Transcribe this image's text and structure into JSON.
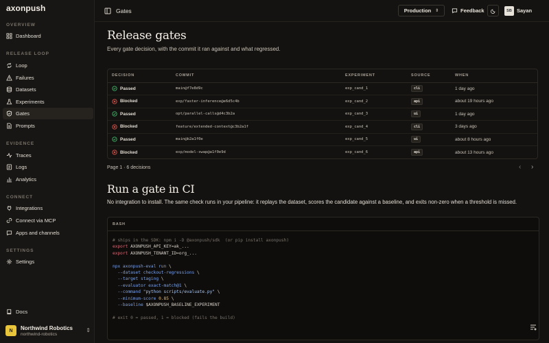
{
  "app": {
    "logo": "axonpush"
  },
  "sidebar": {
    "sections": [
      {
        "label": "OVERVIEW"
      },
      {
        "label": "RELEASE LOOP"
      },
      {
        "label": "EVIDENCE"
      },
      {
        "label": "CONNECT"
      },
      {
        "label": "SETTINGS"
      }
    ],
    "items": {
      "dashboard": "Dashboard",
      "loop": "Loop",
      "failures": "Failures",
      "datasets": "Datasets",
      "experiments": "Experiments",
      "gates": "Gates",
      "prompts": "Prompts",
      "traces": "Traces",
      "logs": "Logs",
      "analytics": "Analytics",
      "integrations": "Integrations",
      "mcp": "Connect via MCP",
      "apps": "Apps and channels",
      "settings": "Settings",
      "docs": "Docs"
    },
    "org": {
      "initial": "N",
      "name": "Northwind Robotics",
      "slug": "northwind-robotics"
    }
  },
  "topbar": {
    "breadcrumb": "Gates",
    "environment": "Production",
    "feedback": "Feedback",
    "user": {
      "initials": "SB",
      "name": "Sayan"
    }
  },
  "gates": {
    "title": "Release gates",
    "subtitle": "Every gate decision, with the commit it ran against and what regressed.",
    "columns": [
      "DECISION",
      "COMMIT",
      "EXPERIMENT",
      "SOURCE",
      "WHEN"
    ],
    "rows": [
      {
        "decision": "Passed",
        "status": "pass",
        "commit": "main@f7e8d9c",
        "experiment": "exp_cand_1",
        "source": "cli",
        "when": "1 day ago"
      },
      {
        "decision": "Blocked",
        "status": "block",
        "commit": "exp/faster-inference@e6d5c4b",
        "experiment": "exp_cand_2",
        "source": "api",
        "when": "about 19 hours ago"
      },
      {
        "decision": "Passed",
        "status": "pass",
        "commit": "opt/parallel-calls@d4c3b2a",
        "experiment": "exp_cand_3",
        "source": "ui",
        "when": "1 day ago"
      },
      {
        "decision": "Blocked",
        "status": "block",
        "commit": "feature/extended-context@c3b2a1f",
        "experiment": "exp_cand_4",
        "source": "cli",
        "when": "3 days ago"
      },
      {
        "decision": "Passed",
        "status": "pass",
        "commit": "main@b2a1f0e",
        "experiment": "exp_cand_5",
        "source": "ui",
        "when": "about 8 hours ago"
      },
      {
        "decision": "Blocked",
        "status": "block",
        "commit": "exp/model-swap@a1f0e9d",
        "experiment": "exp_cand_6",
        "source": "api",
        "when": "about 13 hours ago"
      }
    ],
    "pager": "Page 1 · 6 decisions",
    "colors": {
      "pass": "#3fb96b",
      "block": "#e0564f"
    }
  },
  "ci": {
    "title": "Run a gate in CI",
    "subtitle": "No integration to install. The same check runs in your pipeline: it replays the dataset, scores the candidate against a baseline, and exits non-zero when a threshold is missed.",
    "lang": "BASH",
    "code": {
      "comment1": "# ships in the SDK: npm i -D @axonpush/sdk  (or pip install axonpush)",
      "export_kw": "export",
      "export1": " AXONPUSH_API_KEY=ak_...",
      "export2": " AXONPUSH_TENANT_ID=org_...",
      "cmd": "npx axonpush-eval run",
      "cont": " \\",
      "flag_dataset": "--dataset checkout-regressions",
      "flag_target": "--target staging",
      "flag_evaluator": "--evaluator exact-match@1",
      "flag_command": "--command ",
      "command_str": "\"python scripts/evaluate.py\"",
      "flag_minscore": "--minimum-score ",
      "minscore_val": "0.85",
      "flag_baseline": "--baseline",
      "baseline_var": " $AXONPUSH_BASELINE_EXPERIMENT",
      "comment2": "# exit 0 = passed, 1 = blocked (fails the build)"
    }
  }
}
